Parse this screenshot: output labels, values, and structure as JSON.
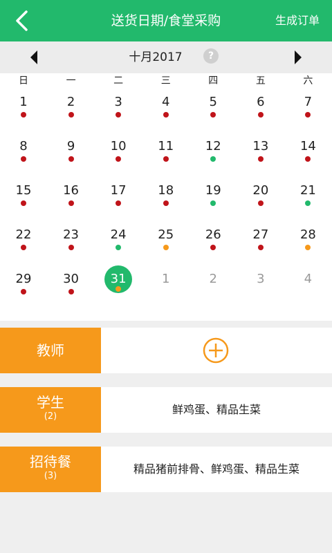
{
  "header": {
    "title": "送货日期/食堂采购",
    "action_label": "生成订单",
    "back_icon": "chevron-left-icon"
  },
  "month_bar": {
    "label": "十月2017",
    "help_label": "?",
    "prev_icon": "triangle-left-icon",
    "next_icon": "triangle-right-icon"
  },
  "colors": {
    "brand_green": "#22b96c",
    "orange": "#f6991b",
    "dot_red": "#c0141a",
    "dot_green": "#22b96c",
    "dot_orange": "#f6991b"
  },
  "calendar": {
    "weekdays": [
      "日",
      "一",
      "二",
      "三",
      "四",
      "五",
      "六"
    ],
    "days": [
      {
        "n": "1",
        "dot": "red"
      },
      {
        "n": "2",
        "dot": "red"
      },
      {
        "n": "3",
        "dot": "red"
      },
      {
        "n": "4",
        "dot": "red"
      },
      {
        "n": "5",
        "dot": "red"
      },
      {
        "n": "6",
        "dot": "red"
      },
      {
        "n": "7",
        "dot": "red"
      },
      {
        "n": "8",
        "dot": "red"
      },
      {
        "n": "9",
        "dot": "red"
      },
      {
        "n": "10",
        "dot": "red"
      },
      {
        "n": "11",
        "dot": "red"
      },
      {
        "n": "12",
        "dot": "green"
      },
      {
        "n": "13",
        "dot": "red"
      },
      {
        "n": "14",
        "dot": "red"
      },
      {
        "n": "15",
        "dot": "red"
      },
      {
        "n": "16",
        "dot": "red"
      },
      {
        "n": "17",
        "dot": "red"
      },
      {
        "n": "18",
        "dot": "red"
      },
      {
        "n": "19",
        "dot": "green"
      },
      {
        "n": "20",
        "dot": "red"
      },
      {
        "n": "21",
        "dot": "green"
      },
      {
        "n": "22",
        "dot": "red"
      },
      {
        "n": "23",
        "dot": "red"
      },
      {
        "n": "24",
        "dot": "green"
      },
      {
        "n": "25",
        "dot": "orange"
      },
      {
        "n": "26",
        "dot": "red"
      },
      {
        "n": "27",
        "dot": "red"
      },
      {
        "n": "28",
        "dot": "orange"
      },
      {
        "n": "29",
        "dot": "red"
      },
      {
        "n": "30",
        "dot": "red"
      },
      {
        "n": "31",
        "dot": "orange",
        "selected": true
      },
      {
        "n": "1",
        "other": true
      },
      {
        "n": "2",
        "other": true
      },
      {
        "n": "3",
        "other": true
      },
      {
        "n": "4",
        "other": true
      }
    ]
  },
  "meals": [
    {
      "name": "教师",
      "count": "",
      "items": "",
      "add_icon": "plus-circle-icon"
    },
    {
      "name": "学生",
      "count": "(2)",
      "items": "鲜鸡蛋、精品生菜"
    },
    {
      "name": "招待餐",
      "count": "(3)",
      "items": "精品猪前排骨、鲜鸡蛋、精品生菜"
    }
  ]
}
